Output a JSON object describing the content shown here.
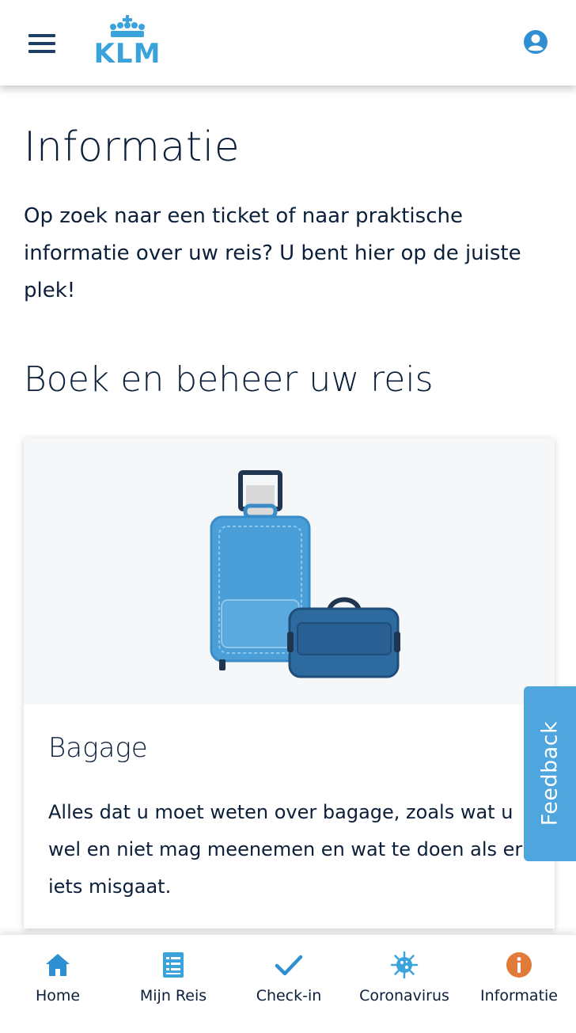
{
  "header": {
    "logo_text": "KLM"
  },
  "page": {
    "title": "Informatie",
    "intro": "Op zoek naar een ticket of naar praktische informatie over uw reis? U bent hier op de juiste plek!",
    "section_title": "Boek en beheer uw reis"
  },
  "card": {
    "title": "Bagage",
    "text": "Alles dat u moet weten over bagage, zoals wat u wel en niet mag meenemen en wat te doen als er iets misgaat.",
    "image_icon": "luggage-illustration"
  },
  "feedback": {
    "label": "Feedback"
  },
  "bottom_nav": {
    "items": [
      {
        "label": "Home",
        "icon": "home-icon"
      },
      {
        "label": "Mijn Reis",
        "icon": "checklist-icon"
      },
      {
        "label": "Check-in",
        "icon": "checkmark-icon"
      },
      {
        "label": "Coronavirus",
        "icon": "virus-icon"
      },
      {
        "label": "Informatie",
        "icon": "info-icon",
        "active": true
      }
    ]
  },
  "colors": {
    "brand_blue": "#3aa3dc",
    "dark_navy": "#0b1f3a",
    "feedback_blue": "#4fa5de",
    "info_orange": "#e07b39"
  }
}
